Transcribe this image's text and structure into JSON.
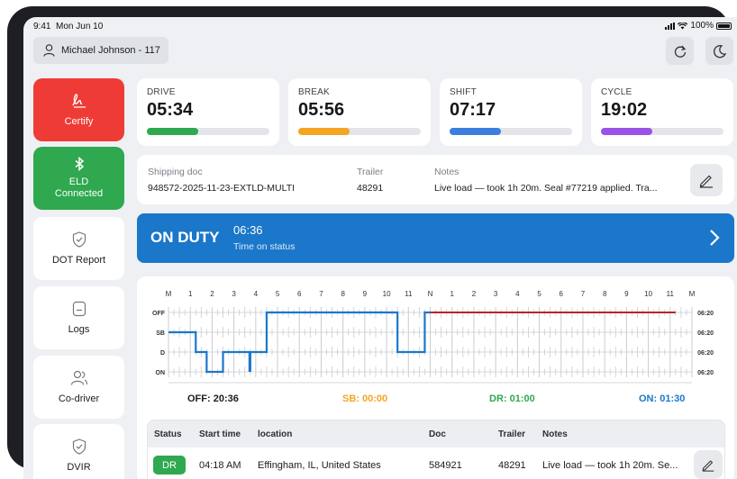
{
  "status_bar": {
    "time": "9:41",
    "date": "Mon Jun 10",
    "battery": "100%"
  },
  "driver": {
    "label": "Michael Johnson - 117"
  },
  "sidebar": {
    "items": [
      {
        "label": "Certify",
        "icon": "signature-icon",
        "color": "#ef3b35"
      },
      {
        "label_line1": "ELD",
        "label_line2": "Connected",
        "icon": "bluetooth-icon",
        "color": "#2fa84f"
      },
      {
        "label": "DOT Report",
        "icon": "shield-check-icon"
      },
      {
        "label": "Logs",
        "icon": "document-icon"
      },
      {
        "label": "Co-driver",
        "icon": "users-icon"
      },
      {
        "label": "DVIR",
        "icon": "shield-check-icon"
      }
    ]
  },
  "timers": [
    {
      "label": "DRIVE",
      "value": "05:34",
      "color": "#2fa84f",
      "progress": 0.42
    },
    {
      "label": "BREAK",
      "value": "05:56",
      "color": "#f4a623",
      "progress": 0.42
    },
    {
      "label": "SHIFT",
      "value": "07:17",
      "color": "#3b7ee0",
      "progress": 0.42
    },
    {
      "label": "CYCLE",
      "value": "19:02",
      "color": "#9b52e8",
      "progress": 0.42
    }
  ],
  "shipping": {
    "doc_label": "Shipping doc",
    "doc_value": "948572-2025-11-23-EXTLD-MULTI",
    "trailer_label": "Trailer",
    "trailer_value": "48291",
    "notes_label": "Notes",
    "notes_value": "Live load — took 1h 20m. Seal #77219 applied. Tra..."
  },
  "duty": {
    "status": "ON DUTY",
    "time": "06:36",
    "subtitle": "Time on status"
  },
  "log_chart": {
    "hour_labels": [
      "M",
      "1",
      "2",
      "3",
      "4",
      "5",
      "6",
      "7",
      "8",
      "9",
      "10",
      "11",
      "N",
      "1",
      "2",
      "3",
      "4",
      "5",
      "6",
      "7",
      "8",
      "9",
      "10",
      "11",
      "M"
    ],
    "rows": [
      "OFF",
      "SB",
      "D",
      "ON"
    ],
    "row_totals": [
      "06:20",
      "06:20",
      "06:20",
      "06:20"
    ],
    "totals": [
      {
        "label": "OFF: 20:36",
        "color": "#111111"
      },
      {
        "label": "SB: 00:00",
        "color": "#f4a623"
      },
      {
        "label": "DR: 01:00",
        "color": "#2fa84f"
      },
      {
        "label": "ON: 01:30",
        "color": "#1b77c9"
      }
    ],
    "line_color": "#1b77c9",
    "future_color": "#b3262f"
  },
  "table": {
    "headers": [
      "Status",
      "Start time",
      "location",
      "Doc",
      "Trailer",
      "Notes"
    ],
    "rows": [
      {
        "status": "DR",
        "start": "04:18 AM",
        "location": "Effingham, IL, United States",
        "doc": "584921",
        "trailer": "48291",
        "notes": "Live load — took 1h 20m. Se..."
      }
    ]
  }
}
